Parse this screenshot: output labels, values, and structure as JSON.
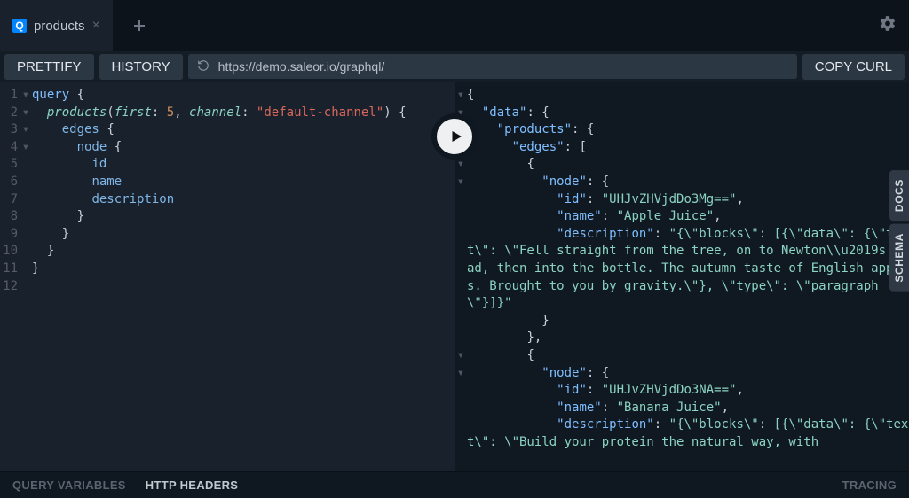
{
  "tab": {
    "badge": "Q",
    "label": "products"
  },
  "toolbar": {
    "prettify": "PRETTIFY",
    "history": "HISTORY",
    "url": "https://demo.saleor.io/graphql/",
    "copycurl": "COPY CURL"
  },
  "side": {
    "docs": "DOCS",
    "schema": "SCHEMA"
  },
  "footer": {
    "vars": "QUERY VARIABLES",
    "headers": "HTTP HEADERS",
    "tracing": "TRACING"
  },
  "query": {
    "keyword": "query",
    "root": "products",
    "first_arg": "first",
    "first_val": "5",
    "channel_arg": "channel",
    "channel_val": "\"default-channel\"",
    "edges": "edges",
    "node": "node",
    "id": "id",
    "name": "name",
    "description": "description"
  },
  "result": {
    "data": "\"data\"",
    "products": "\"products\"",
    "edges": "\"edges\"",
    "node": "\"node\"",
    "id_k": "\"id\"",
    "name_k": "\"name\"",
    "desc_k": "\"description\"",
    "id1": "\"UHJvZHVjdDo3Mg==\"",
    "name1": "\"Apple Juice\"",
    "desc1": "\"{\\\"blocks\\\": [{\\\"data\\\": {\\\"text\\\": \\\"Fell straight from the tree, on to Newton\\\\u2019s head, then into the bottle. The autumn taste of English apples. Brought to you by gravity.\\\"}, \\\"type\\\": \\\"paragraph\\\"}]}\"",
    "id2": "\"UHJvZHVjdDo3NA==\"",
    "name2": "\"Banana Juice\"",
    "desc2": "\"{\\\"blocks\\\": [{\\\"data\\\": {\\\"text\\\": \\\"Build your protein the natural way, with"
  }
}
